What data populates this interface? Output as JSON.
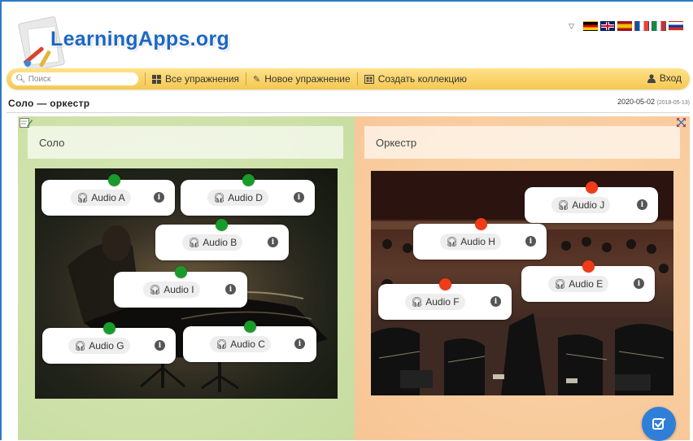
{
  "header": {
    "logo_text": "LearningApps.org",
    "languages": [
      {
        "code": "de",
        "colors": [
          "#000000",
          "#dd0000",
          "#ffce00"
        ]
      },
      {
        "code": "en",
        "colors": [
          "#012169",
          "#ffffff",
          "#c8102e"
        ]
      },
      {
        "code": "es",
        "colors": [
          "#aa151b",
          "#f1bf00",
          "#aa151b"
        ]
      },
      {
        "code": "fr",
        "colors": [
          "#0055a4",
          "#ffffff",
          "#ef4135"
        ]
      },
      {
        "code": "it",
        "colors": [
          "#009246",
          "#ffffff",
          "#ce2b37"
        ]
      },
      {
        "code": "ru",
        "colors": [
          "#ffffff",
          "#0039a6",
          "#d52b1e"
        ]
      }
    ]
  },
  "nav": {
    "search_placeholder": "Поиск",
    "all_exercises": "Все упражнения",
    "new_exercise": "Новое упражнение",
    "create_collection": "Создать коллекцию",
    "login": "Вход",
    "accent_color": "#f5c850"
  },
  "page": {
    "title": "Соло — оркестр",
    "date": "2020-05-02",
    "date_small": "(2018-05-13)"
  },
  "categories": {
    "left": {
      "label": "Соло",
      "color": "#c6dca0"
    },
    "right": {
      "label": "Оркестр",
      "color": "#f7c595"
    }
  },
  "cards": {
    "a": {
      "label": "Audio A",
      "dot": "green"
    },
    "d": {
      "label": "Audio D",
      "dot": "green"
    },
    "b": {
      "label": "Audio B",
      "dot": "green"
    },
    "i": {
      "label": "Audio I",
      "dot": "green"
    },
    "g": {
      "label": "Audio G",
      "dot": "green"
    },
    "c": {
      "label": "Audio C",
      "dot": "green"
    },
    "j": {
      "label": "Audio J",
      "dot": "red"
    },
    "h": {
      "label": "Audio H",
      "dot": "red"
    },
    "e": {
      "label": "Audio E",
      "dot": "red"
    },
    "f": {
      "label": "Audio F",
      "dot": "red"
    }
  },
  "icons": {
    "search": "search-icon",
    "grid": "grid-icon",
    "pencil": "pencil-icon",
    "collection": "collection-icon",
    "user": "user-icon",
    "headphones": "headphones-icon",
    "info": "info-icon",
    "check": "check-icon"
  }
}
